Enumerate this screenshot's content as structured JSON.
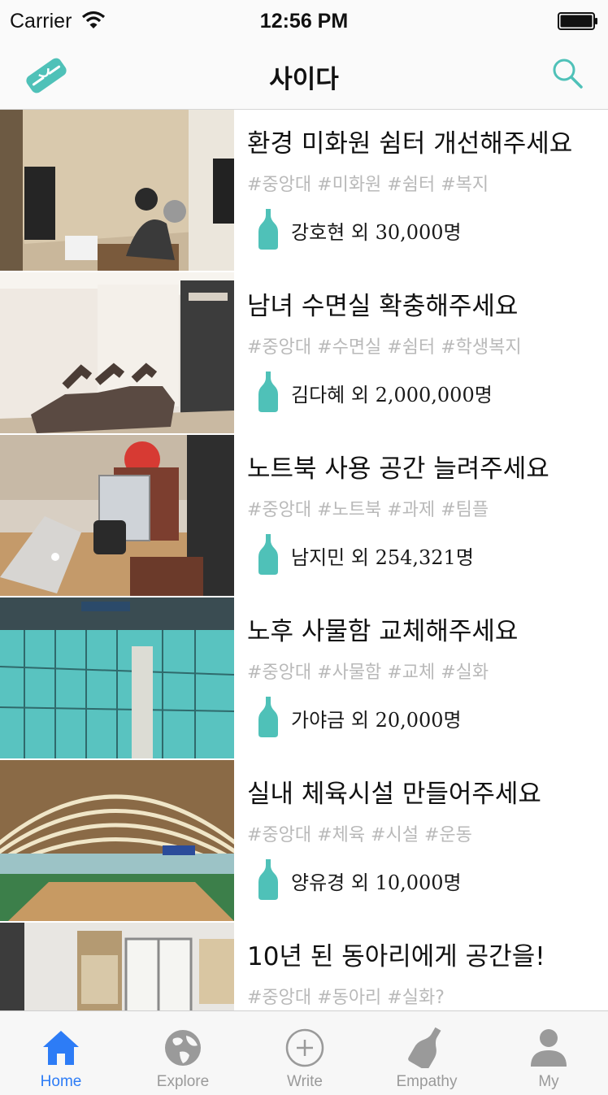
{
  "status_bar": {
    "carrier": "Carrier",
    "time": "12:56 PM"
  },
  "nav": {
    "title": "사이다"
  },
  "colors": {
    "accent": "#4fc1b8",
    "tab_active": "#2d7cf6",
    "tab_inactive": "#9a9a9a"
  },
  "posts": [
    {
      "title": "환경 미화원 쉼터 개선해주세요",
      "tags": "#중앙대 #미화원 #쉼터 #복지",
      "count": "강호현 외 30,000명"
    },
    {
      "title": "남녀 수면실 확충해주세요",
      "tags": "#중앙대 #수면실 #쉼터 #학생복지",
      "count": "김다혜 외 2,000,000명"
    },
    {
      "title": "노트북 사용 공간 늘려주세요",
      "tags": "#중앙대 #노트북 #과제 #팀플",
      "count": "남지민 외 254,321명"
    },
    {
      "title": "노후 사물함 교체해주세요",
      "tags": "#중앙대 #사물함 #교체 #실화",
      "count": "가야금 외 20,000명"
    },
    {
      "title": "실내 체육시설 만들어주세요",
      "tags": "#중앙대 #체육 #시설 #운동",
      "count": "양유경 외 10,000명"
    },
    {
      "title": "10년 된 동아리에게 공간을!",
      "tags": "#중앙대 #동아리 #실화?",
      "count": ""
    }
  ],
  "tabs": [
    {
      "label": "Home",
      "icon": "home-icon",
      "active": true
    },
    {
      "label": "Explore",
      "icon": "globe-icon",
      "active": false
    },
    {
      "label": "Write",
      "icon": "plus-circle-icon",
      "active": false
    },
    {
      "label": "Empathy",
      "icon": "bottle-icon",
      "active": false
    },
    {
      "label": "My",
      "icon": "person-icon",
      "active": false
    }
  ]
}
